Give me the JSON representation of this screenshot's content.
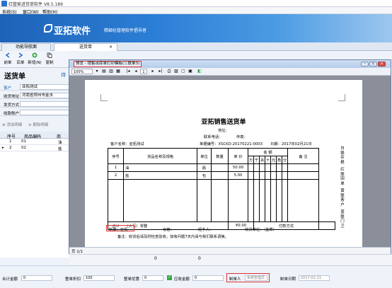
{
  "window": {
    "title": "红管家进货单软件 V8.5.189"
  },
  "menu": {
    "items": [
      "系统(S)",
      "窗口(W)",
      "帮助(H)"
    ]
  },
  "banner": {
    "brand": "亚拓软件",
    "slogan": "精细化管理软件倡导者"
  },
  "tabs": [
    {
      "label": "功能导航面"
    },
    {
      "label": "送货单"
    }
  ],
  "tab_close": "×",
  "left": {
    "toolbar": [
      {
        "label": "前单",
        "icon": "arrow-left-icon"
      },
      {
        "label": "后单",
        "icon": "arrow-right-icon"
      },
      {
        "label": "新增(N)",
        "icon": "add-icon"
      },
      {
        "label": "复制",
        "icon": "copy-icon"
      }
    ],
    "doc_title": "送货单",
    "doc_title_suffix": "待",
    "fields": [
      {
        "label": "客户",
        "value": "亚拓测试"
      },
      {
        "label": "收货地址",
        "value": "河南省郑州市金水"
      },
      {
        "label": "发货方式",
        "value": ""
      },
      {
        "label": "收款账户",
        "value": ""
      }
    ],
    "grid_actions": [
      "添加明细",
      "删除明细"
    ],
    "grid_headers": [
      "序号",
      "商品编码",
      "商"
    ],
    "grid_rows": [
      {
        "no": "1",
        "code": "01",
        "name": "油"
      },
      {
        "no": "2",
        "code": "02",
        "name": "盐"
      }
    ]
  },
  "preview": {
    "title": "预览 - 销售出库单打印模板(三联单3)",
    "zoom": "100%",
    "page_indicator": "1",
    "status": "页 1/1",
    "paper": {
      "company_title": "亚拓销售送货单",
      "address_label": "地址：",
      "phone_label": "联系电话：",
      "fax_label": "传真：",
      "customer": "客户名称：亚拓测试",
      "doc_no": "单据编号：XSCKD-20170221-0003",
      "date": "日期：2017年02月21日",
      "table_headers": [
        "序号",
        "货品名称及规格",
        "单位",
        "数量",
        "单 价",
        "金 额",
        "备 注"
      ],
      "amount_subheaders": [
        "万",
        "千",
        "百",
        "十",
        "元",
        "角",
        "分"
      ],
      "rows": [
        {
          "no": "1",
          "name": "油",
          "unit": "瓶",
          "qty": "",
          "price": "50.00"
        },
        {
          "no": "2",
          "name": "盐",
          "unit": "包",
          "qty": "",
          "price": "5.00"
        }
      ],
      "total_label": "合计",
      "total_upper": "（大写）零整",
      "total_amount": "¥0.00",
      "payment_label": "付款方式",
      "maker": "制单：亚拓",
      "warehouse": "仓管：",
      "handler": "经手人：",
      "receiver": "收货单位：（盖章）",
      "note": "备注：收货后请及时检查验收，如有问题7天内请与我们联系调换。",
      "side_labels": [
        "白联存根",
        "红联回单",
        "黄联客户",
        "蓝联门卫"
      ]
    }
  },
  "bottom": {
    "scroll_vals": [
      "0",
      "0"
    ],
    "total_label": "合计金额",
    "total_value": "0",
    "discount_label": "整单折扣",
    "discount_value": "100",
    "discount_amt_label": "整单优惠",
    "discount_amt_value": "0",
    "received_label": "应收金额",
    "received_value": "0",
    "maker_label": "制单人",
    "maker_value": "系统管理员",
    "date_label": "制单日期",
    "date_value": "2017-02-21"
  }
}
